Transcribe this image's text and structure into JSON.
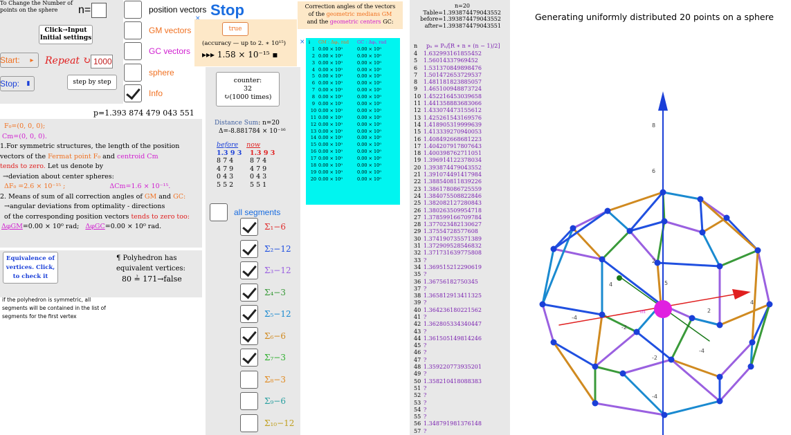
{
  "left": {
    "change_label": "To Change the Number of points on the sphere",
    "n_value": "n=20",
    "click_input_label": "Click→Input Initial settings",
    "start_label": "Start:",
    "repeat_label": "Repeat",
    "repeat_value": "1000",
    "stop_label": "Stop:",
    "step_label": "step by step",
    "p_value": "p=1.393 874 479 043 551",
    "f0": "F₀=(0, 0, 0);",
    "cm": "Cm=(0, 0, 0).",
    "text1a": "1.For symmetric structures, the length of the position",
    "text1b_pre": "vectors of the",
    "fermat": "Fermat point F₀",
    "and": "and",
    "centroid": "centroid Cm",
    "text1c": "tends to zero.",
    "text1d": "Let us denote by",
    "text1e": "→deviation about center spheres:",
    "delta_f": "ΔF₀ =2.6 × 10⁻¹⁵ ;",
    "delta_cm": "ΔCm=1.6 × 10⁻¹⁵.",
    "text2a_pre": "2. Means of sum of all correction angles of",
    "gm": "GM",
    "gc": "GC:",
    "text2b": "→angular deviations from optimality - directions",
    "text2c_pre": "of the corresponding position vectors",
    "text2c_red": "tends to zero too:",
    "dphi_gm_lbl": "ΔφGM",
    "dphi_gm_val": "=0.00 × 10⁰  rad;",
    "dphi_gc_lbl": "ΔφGC",
    "dphi_gc_val": "=0.00 × 10⁰  rad.",
    "equiv_label": "Equivalence of vertices. Click, to check it",
    "poly_line1": "¶ Polyhedron has",
    "poly_line2": "equivalent vertices:",
    "poly_line3": "80 ≟ 171→false",
    "sym_note": "if the polyhedron is symmetric, all segments will be contained in the list of segments for the first vertex"
  },
  "middle": {
    "checkboxes": [
      {
        "label": "position vectors",
        "checked": false
      },
      {
        "label": "GM vectors",
        "checked": false
      },
      {
        "label": "GC vectors",
        "checked": false
      },
      {
        "label": "sphere",
        "checked": false
      },
      {
        "label": "Info",
        "checked": true
      }
    ],
    "stop_title": "Stop",
    "true_btn": "true",
    "accuracy_line1": "(accuracy — up to 2. ∗ 10¹⁵)",
    "accuracy_line2": "▸▸▸ 1.58 × 10⁻¹⁵ ▪",
    "counter_label": "counter:",
    "counter_value": "32",
    "counter_times": "↻(1000 times)",
    "distance_title": "Distance Sum",
    "distance_n": ": n=20",
    "distance_delta": "Δ=-8.881784 × 10⁻¹⁶",
    "before": "before",
    "now": "now",
    "before_digits": [
      "1.3 9 3",
      "8 7 4",
      "4 7 9",
      "0 4 3",
      "5 5 2"
    ],
    "now_digits": [
      "1.3 9 3",
      "8 7 4",
      "4 7 9",
      "0 4 3",
      "5 5 1"
    ],
    "all_segments": "all segments",
    "segments": [
      {
        "label": "Σ₁−6",
        "checked": true,
        "color": "#e03030"
      },
      {
        "label": "Σ₂−12",
        "checked": true,
        "color": "#2050e0"
      },
      {
        "label": "Σ₃−12",
        "checked": true,
        "color": "#9a60e0"
      },
      {
        "label": "Σ₄−3",
        "checked": true,
        "color": "#3a9a3a"
      },
      {
        "label": "Σ₅−12",
        "checked": true,
        "color": "#1a8ad0"
      },
      {
        "label": "Σ₆−6",
        "checked": true,
        "color": "#d08a20"
      },
      {
        "label": "Σ₇−3",
        "checked": true,
        "color": "#30b030"
      },
      {
        "label": "Σ₈−3",
        "checked": false,
        "color": "#e08a20"
      },
      {
        "label": "Σ₉−6",
        "checked": false,
        "color": "#2aa0a0"
      },
      {
        "label": "Σ₁₀−12",
        "checked": false,
        "color": "#c0a020"
      }
    ]
  },
  "correction": {
    "title_line1": "Correction angles of the vectors",
    "title_line2_pre": "of the",
    "title_gm": "geometric medians GM",
    "title_line3_pre": "and the",
    "title_gc": "geometric centers",
    "title_line3_post": "GC:",
    "header_i": "i",
    "header_gm": "GM : Δφᵢ, rad",
    "header_gc": "GC : Δφᵢ, rad",
    "cell_value": "0.00 × 10⁰",
    "rows": [
      "1",
      "2",
      "3",
      "4",
      "5",
      "6",
      "7",
      "8",
      "9",
      "10",
      "11",
      "12",
      "13",
      "14",
      "15",
      "16",
      "17",
      "18",
      "19",
      "20"
    ]
  },
  "table": {
    "n": "n=20",
    "table_lbl": "Table=",
    "table_val": "1.393874479043552",
    "before_lbl": "before=",
    "before_val": "1.393874479043552",
    "after_lbl": "after=",
    "after_val": "1.393874479043551",
    "col_n": "n",
    "col_p": "pₙ = Pₙ/[R ∗ n ∗ (n − 1)/2]",
    "rows": [
      [
        "4",
        "1.632993161855452"
      ],
      [
        "5",
        "1.56014337969452"
      ],
      [
        "6",
        "1.531370849898476"
      ],
      [
        "7",
        "1.501472653729537"
      ],
      [
        "8",
        "1.481181823885057"
      ],
      [
        "9",
        "1.465100948873724"
      ],
      [
        "10",
        "1.452216453039658"
      ],
      [
        "11",
        "1.441358883683066"
      ],
      [
        "12",
        "1.433074473155612"
      ],
      [
        "13",
        "1.425261543169576"
      ],
      [
        "14",
        "1.418905319999639"
      ],
      [
        "15",
        "1.413339270940053"
      ],
      [
        "16",
        "1.408492668681223"
      ],
      [
        "17",
        "1.404207917807643"
      ],
      [
        "18",
        "1.400398762711051"
      ],
      [
        "19",
        "1.396914122378034"
      ],
      [
        "20",
        "1.393874479043552"
      ],
      [
        "21",
        "1.391074491417984"
      ],
      [
        "22",
        "1.388540811839226"
      ],
      [
        "23",
        "1.386178086725559"
      ],
      [
        "24",
        "1.384075508822846"
      ],
      [
        "25",
        "1.382082127280843"
      ],
      [
        "26",
        "1.380263509954718"
      ],
      [
        "27",
        "1.378599166709784"
      ],
      [
        "28",
        "1.377023482130627"
      ],
      [
        "29",
        "1.37554728577608"
      ],
      [
        "30",
        "1.374190735571389"
      ],
      [
        "31",
        "1.372909528546832"
      ],
      [
        "32",
        "1.371731639775808"
      ],
      [
        "33",
        "?"
      ],
      [
        "34",
        "1.369515212290619"
      ],
      [
        "35",
        "?"
      ],
      [
        "36",
        "1.36756182750345"
      ],
      [
        "37",
        "?"
      ],
      [
        "38",
        "1.365812913411325"
      ],
      [
        "39",
        "?"
      ],
      [
        "40",
        "1.364236180221562"
      ],
      [
        "41",
        "?"
      ],
      [
        "42",
        "1.362805334340447"
      ],
      [
        "43",
        "?"
      ],
      [
        "44",
        "1.361505149814246"
      ],
      [
        "45",
        "?"
      ],
      [
        "46",
        "?"
      ],
      [
        "47",
        "?"
      ],
      [
        "48",
        "1.359220773935201"
      ],
      [
        "49",
        "?"
      ],
      [
        "50",
        "1.358210418088383"
      ],
      [
        "51",
        "?"
      ],
      [
        "52",
        "?"
      ],
      [
        "53",
        "?"
      ],
      [
        "54",
        "?"
      ],
      [
        "55",
        "?"
      ],
      [
        "56",
        "1.348791981376148"
      ],
      [
        "57",
        "?"
      ]
    ]
  },
  "graphics": {
    "title": "Generating uniformly distributed  20 points on a sphere",
    "axis_labels_z": [
      "8",
      "6",
      "2",
      "-2",
      "-4"
    ],
    "axis_labels_x": [
      "4",
      "2",
      "-4",
      "-2",
      "-4"
    ],
    "mid_label": "m"
  }
}
